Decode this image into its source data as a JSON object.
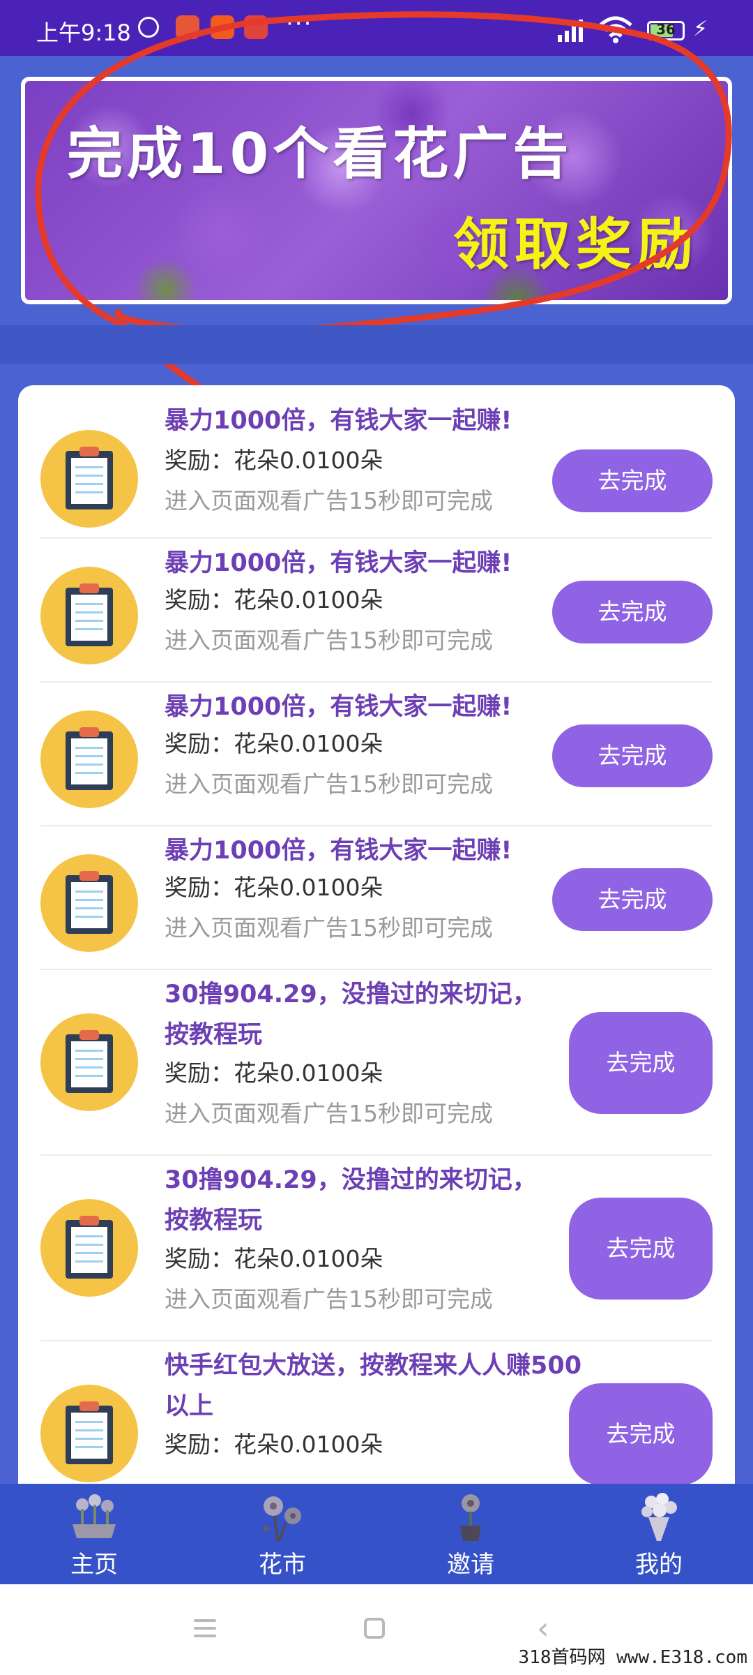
{
  "status_bar": {
    "time": "上午9:18",
    "dots": "···",
    "battery": "36",
    "icons": [
      "alarm-icon",
      "app-notification-icon",
      "taobao-icon",
      "app-notification-icon",
      "signal-icon",
      "wifi-icon",
      "battery-icon",
      "charging-icon"
    ]
  },
  "banner": {
    "title": "完成10个看花广告",
    "subtitle": "领取奖励",
    "title_color": "#ffffff",
    "subtitle_color": "#f6f214"
  },
  "tasks": [
    {
      "title": "暴力1000倍，有钱大家一起赚!",
      "reward": "奖励：花朵0.0100朵",
      "desc": "进入页面观看广告15秒即可完成",
      "button": "去完成",
      "icon": "clipboard-icon"
    },
    {
      "title": "暴力1000倍，有钱大家一起赚!",
      "reward": "奖励：花朵0.0100朵",
      "desc": "进入页面观看广告15秒即可完成",
      "button": "去完成",
      "icon": "clipboard-icon"
    },
    {
      "title": "暴力1000倍，有钱大家一起赚!",
      "reward": "奖励：花朵0.0100朵",
      "desc": "进入页面观看广告15秒即可完成",
      "button": "去完成",
      "icon": "clipboard-icon"
    },
    {
      "title": "暴力1000倍，有钱大家一起赚!",
      "reward": "奖励：花朵0.0100朵",
      "desc": "进入页面观看广告15秒即可完成",
      "button": "去完成",
      "icon": "clipboard-icon"
    },
    {
      "title": "30撸904.29，没撸过的来切记，按教程玩",
      "reward": "奖励：花朵0.0100朵",
      "desc": "进入页面观看广告15秒即可完成",
      "button": "去完成",
      "icon": "clipboard-icon"
    },
    {
      "title": "30撸904.29，没撸过的来切记，按教程玩",
      "reward": "奖励：花朵0.0100朵",
      "desc": "进入页面观看广告15秒即可完成",
      "button": "去完成",
      "icon": "clipboard-icon"
    },
    {
      "title": "快手红包大放送，按教程来人人赚500以上",
      "reward": "奖励：花朵0.0100朵",
      "desc": "",
      "button": "去完成",
      "icon": "clipboard-icon"
    }
  ],
  "bottom_nav": [
    {
      "label": "主页",
      "icon": "flower-pot-icon"
    },
    {
      "label": "花市",
      "icon": "flowers-icon"
    },
    {
      "label": "邀请",
      "icon": "potted-flower-icon"
    },
    {
      "label": "我的",
      "icon": "bouquet-icon"
    }
  ],
  "watermark": "318首码网 www.E318.com",
  "colors": {
    "background": "#4a63d1",
    "status_bar": "#4a22b8",
    "accent_button": "#8f63e4",
    "task_title": "#6d3fb4",
    "icon_circle": "#f5c446",
    "bottom_nav": "#3552c8",
    "annotation_stroke": "#e53a2a"
  }
}
